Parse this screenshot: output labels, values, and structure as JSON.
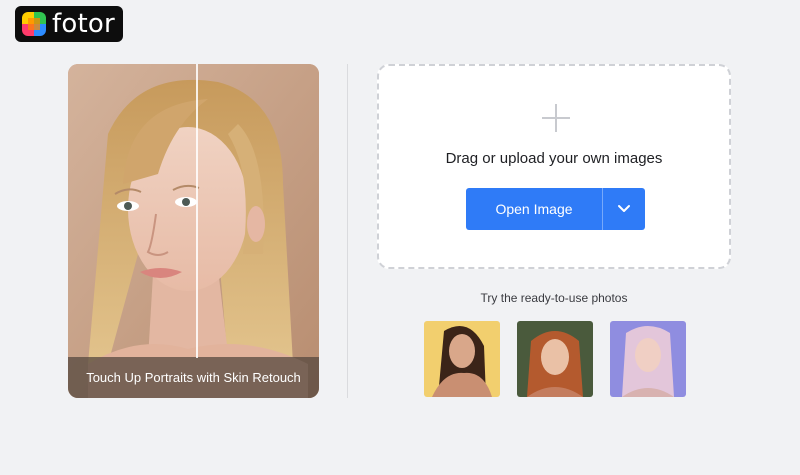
{
  "brand": {
    "name": "fotor"
  },
  "preview": {
    "caption": "Touch Up Portraits with Skin Retouch"
  },
  "upload": {
    "prompt": "Drag or upload your own images",
    "open_button": "Open Image"
  },
  "samples": {
    "label": "Try the ready-to-use photos",
    "items": [
      "sample-photo-1",
      "sample-photo-2",
      "sample-photo-3"
    ]
  },
  "colors": {
    "accent": "#2f7bf7",
    "background": "#f1f2f4"
  }
}
